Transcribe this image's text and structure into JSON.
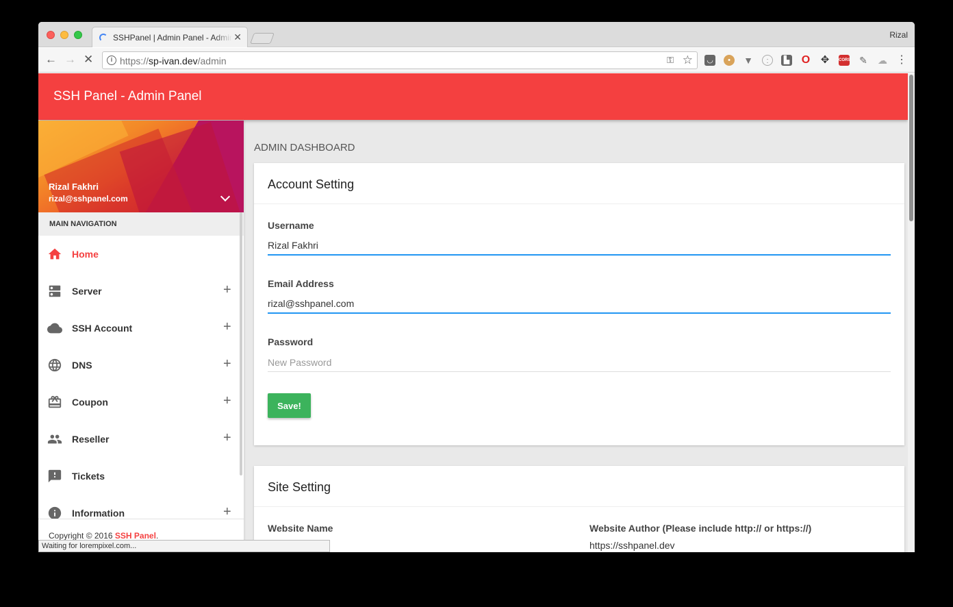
{
  "browser": {
    "tab_title": "SSHPanel | Admin Panel - Admin",
    "profile_name": "Rizal",
    "url_scheme": "https://",
    "url_host": "sp-ivan.dev",
    "url_path": "/admin",
    "status_text": "Waiting for lorempixel.com..."
  },
  "app": {
    "title": "SSH Panel - Admin Panel",
    "accent_color": "#f44040"
  },
  "user": {
    "name": "Rizal Fakhri",
    "email": "rizal@sshpanel.com"
  },
  "sidebar": {
    "header": "MAIN NAVIGATION",
    "items": [
      {
        "label": "Home",
        "icon": "home-icon",
        "active": true,
        "expandable": false
      },
      {
        "label": "Server",
        "icon": "server-icon",
        "active": false,
        "expandable": true
      },
      {
        "label": "SSH Account",
        "icon": "cloud-icon",
        "active": false,
        "expandable": true
      },
      {
        "label": "DNS",
        "icon": "globe-icon",
        "active": false,
        "expandable": true
      },
      {
        "label": "Coupon",
        "icon": "gift-card-icon",
        "active": false,
        "expandable": true
      },
      {
        "label": "Reseller",
        "icon": "group-icon",
        "active": false,
        "expandable": true
      },
      {
        "label": "Tickets",
        "icon": "feedback-icon",
        "active": false,
        "expandable": false
      },
      {
        "label": "Information",
        "icon": "info-icon",
        "active": false,
        "expandable": true
      }
    ],
    "footer_prefix": "Copyright © 2016 ",
    "footer_brand": "SSH Panel",
    "footer_suffix": "."
  },
  "main": {
    "page_title": "ADMIN DASHBOARD",
    "account_setting": {
      "title": "Account Setting",
      "username_label": "Username",
      "username_value": "Rizal Fakhri",
      "email_label": "Email Address",
      "email_value": "rizal@sshpanel.com",
      "password_label": "Password",
      "password_placeholder": "New Password",
      "save_label": "Save!"
    },
    "site_setting": {
      "title": "Site Setting",
      "website_name_label": "Website Name",
      "website_author_label": "Website Author (Please include http:// or https://)",
      "website_author_value": "https://sshpanel.dev"
    }
  }
}
